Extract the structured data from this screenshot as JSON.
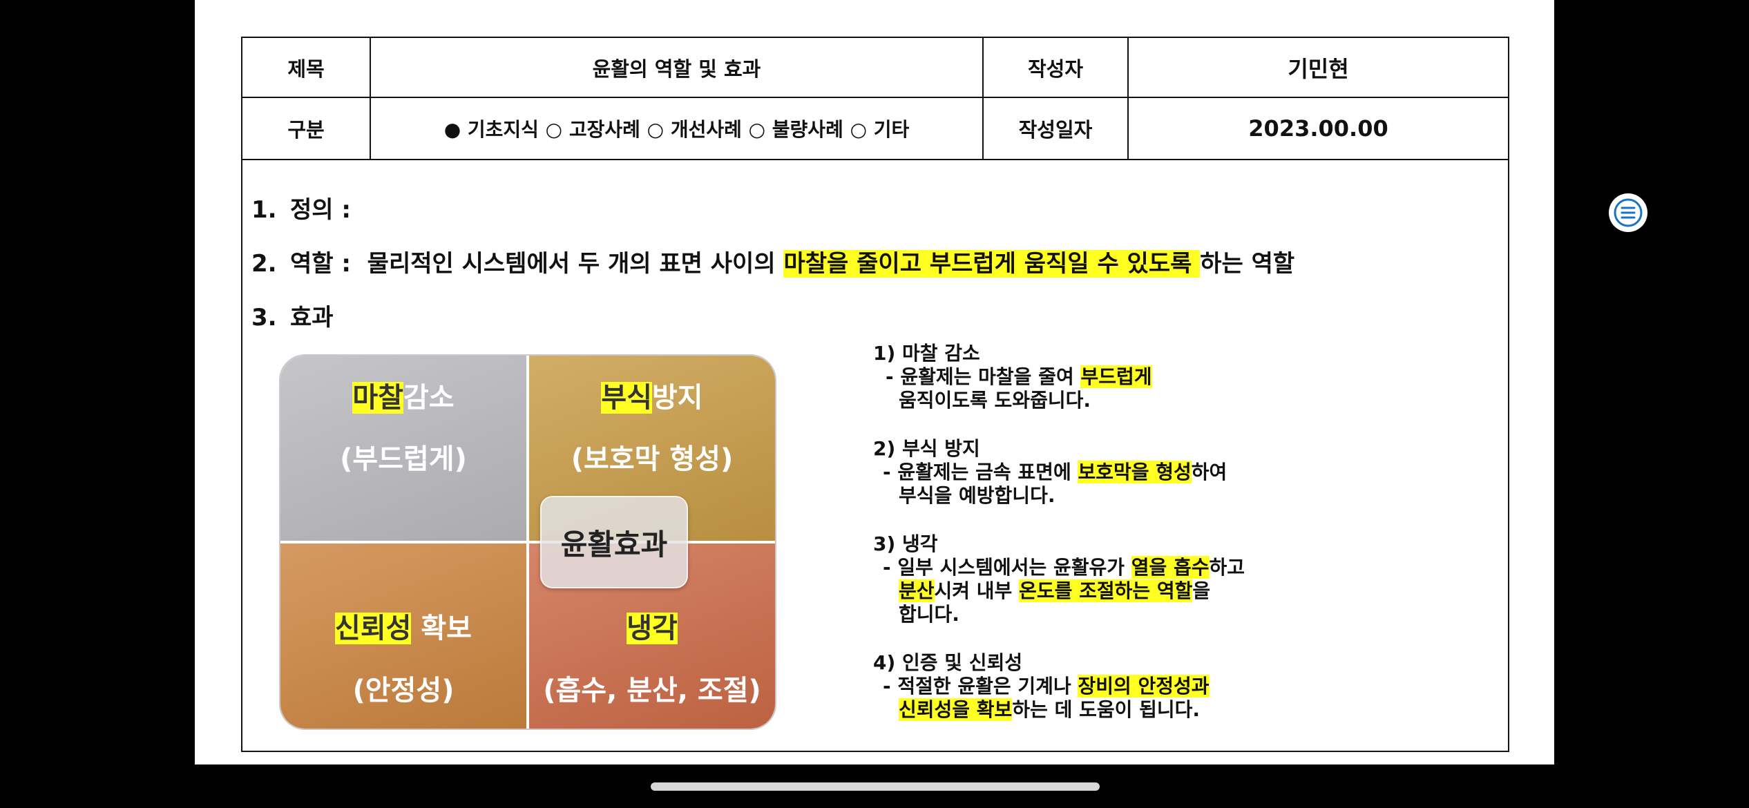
{
  "header": {
    "title_label": "제목",
    "title_value": "윤활의 역할 및 효과",
    "author_label": "작성자",
    "author_value": "기민현",
    "category_label": "구분",
    "category_options": "● 기초지식 ○ 고장사례 ○ 개선사례 ○ 불량사례 ○ 기타",
    "date_label": "작성일자",
    "date_value": "2023.00.00"
  },
  "sections": {
    "s1_num": "1.",
    "s1_text": "정의 :",
    "s2_num": "2.",
    "s2_pre": "역할 :  물리적인 시스템에서 두 개의 표면 사이의 ",
    "s2_hl": "마찰을 줄이고 부드럽게 움직일 수 있도록 ",
    "s2_post": "하는 역할",
    "s3_num": "3.",
    "s3_text": "효과"
  },
  "diagram": {
    "center": "윤활효과",
    "q1_hl": "마찰",
    "q1_rest": "감소",
    "q1_sub": "(부드럽게)",
    "q2_hl": "부식",
    "q2_rest": "방지",
    "q2_sub": "(보호막 형성)",
    "q3_hl": "신뢰성",
    "q3_rest": " 확보",
    "q3_sub": "(안정성)",
    "q4_hl": "냉각",
    "q4_sub": "(흡수, 분산, 조절)",
    "colors": {
      "q1": "#b9b9be",
      "q2": "#c89b45",
      "q3": "#cc843f",
      "q4": "#cc6a47"
    }
  },
  "effects": {
    "e1_title": "1) 마찰 감소",
    "e1_a": "- 윤활제는 마찰을 줄여 ",
    "e1_a_hl": "부드럽게",
    "e1_b": "움직이도록 도와줍니다.",
    "e2_title": "2) 부식 방지",
    "e2_a": "- 윤활제는 금속 표면에 ",
    "e2_a_hl": "보호막을 형성",
    "e2_a_post": "하여",
    "e2_b": "부식을 예방합니다.",
    "e3_title": "3) 냉각",
    "e3_a": "- 일부 시스템에서는 윤활유가 ",
    "e3_a_hl": "열을 흡수",
    "e3_a_post": "하고",
    "e3_b_hl": "분산",
    "e3_b_mid": "시켜 내부 ",
    "e3_b_hl2": "온도를 조절하는 역할",
    "e3_b_post": "을",
    "e3_c": "합니다.",
    "e4_title": "4) 인증 및 신뢰성",
    "e4_a": "- 적절한 윤활은 기계나 ",
    "e4_a_hl": "장비의 안정성과",
    "e4_b_hl": "신뢰성을 확보",
    "e4_b_post": "하는 데 도움이 됩니다."
  },
  "ui": {
    "fab_icon": "menu-lines-icon"
  }
}
